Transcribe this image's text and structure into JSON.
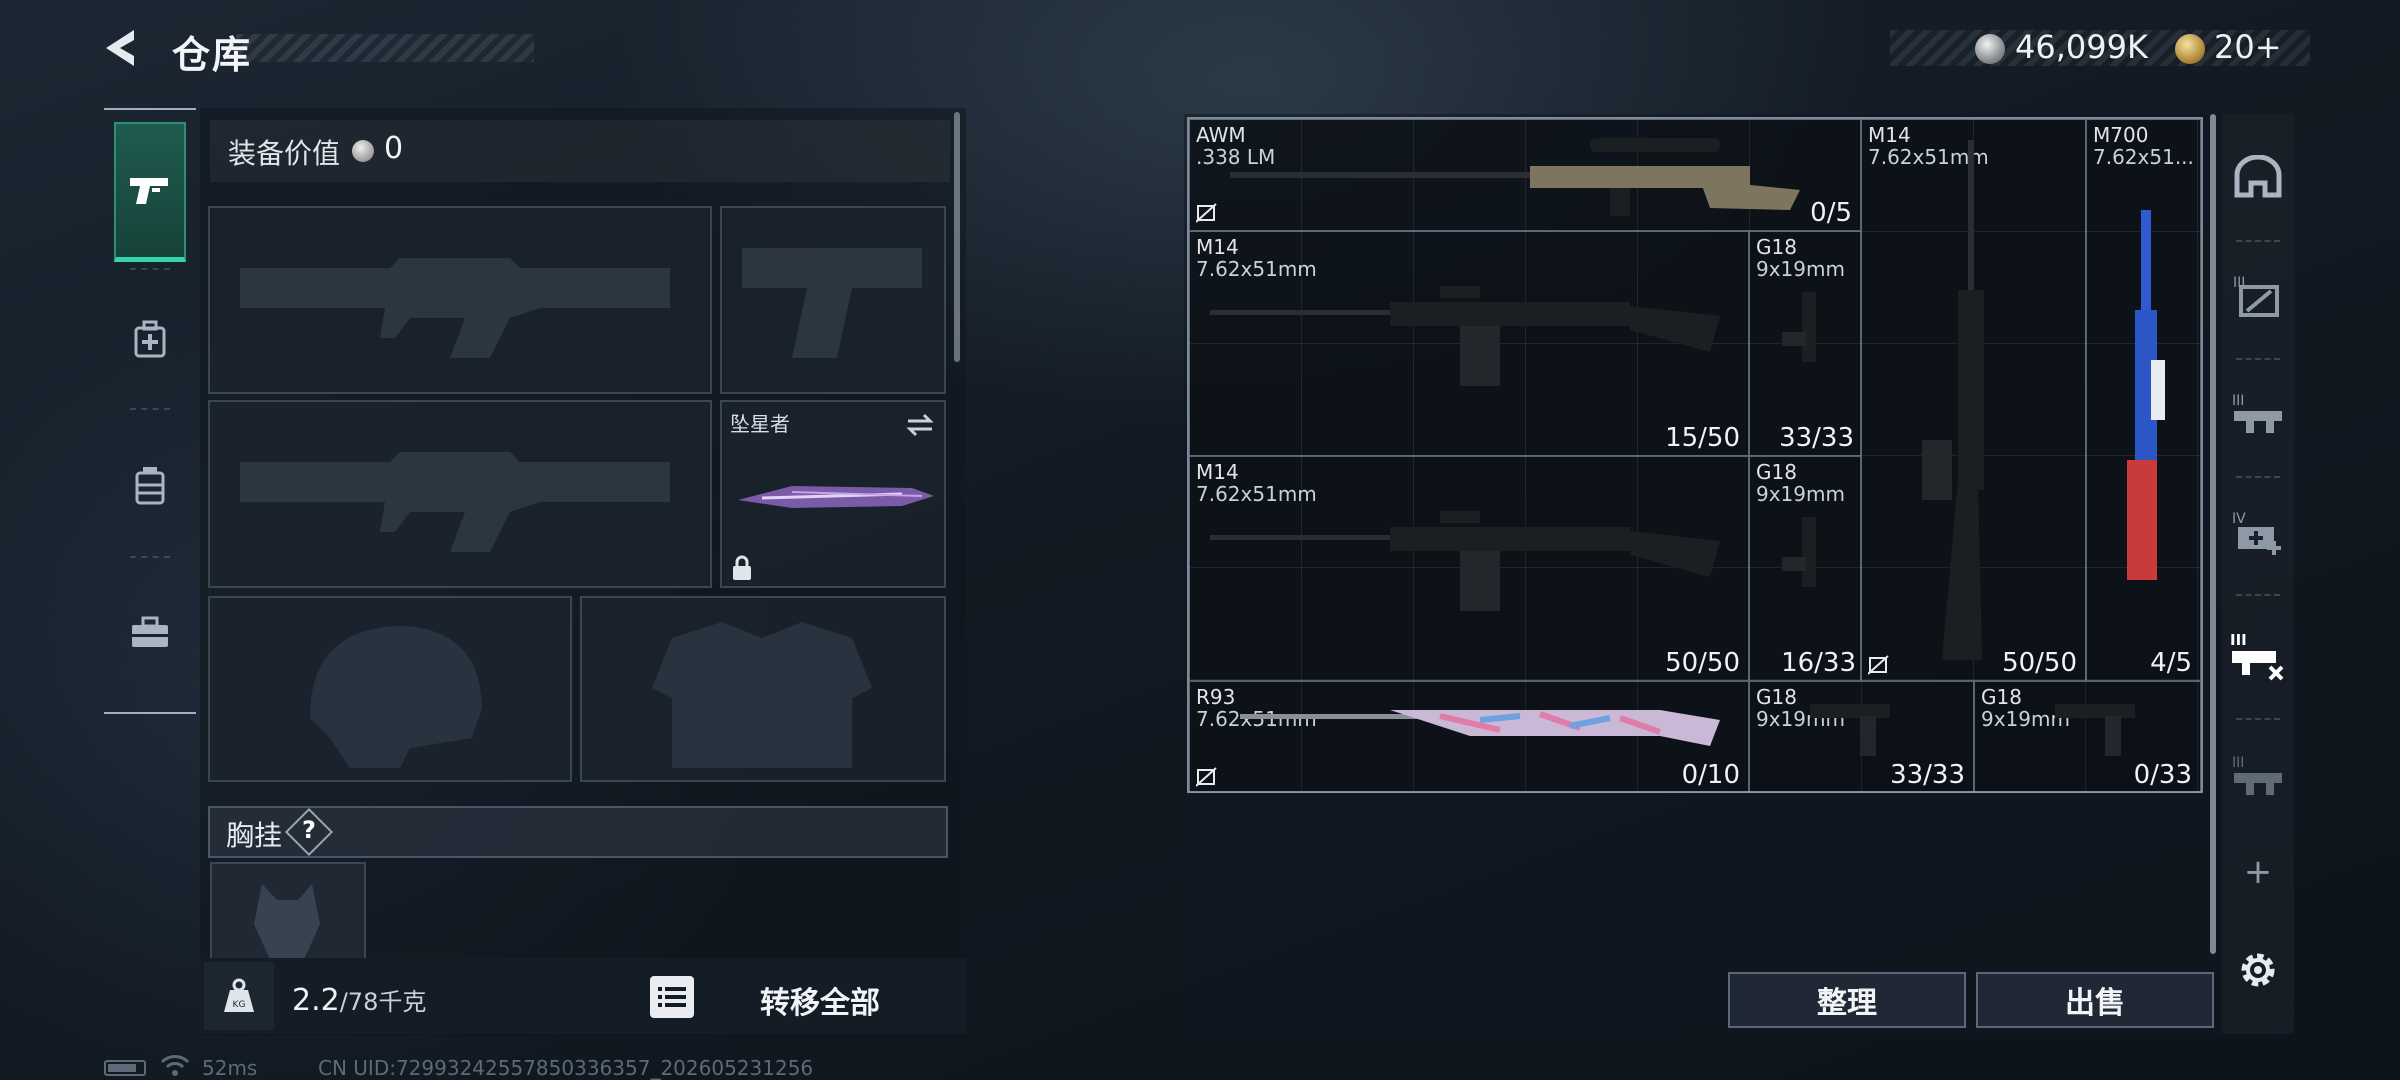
{
  "header": {
    "title": "仓库",
    "currency_silver": "46,099K",
    "currency_gold": "20+"
  },
  "sidebar": {
    "tabs": [
      {
        "name": "weapons",
        "icon": "pistol-icon",
        "active": true
      },
      {
        "name": "supplies",
        "icon": "medkit-icon",
        "active": false
      },
      {
        "name": "containers",
        "icon": "canister-icon",
        "active": false
      },
      {
        "name": "gear",
        "icon": "toolbox-icon",
        "active": false
      }
    ]
  },
  "loadout": {
    "equip_value_label": "装备价值",
    "equip_value": "0",
    "melee_label": "坠星者",
    "chest_label": "胸挂",
    "chest_help": "?",
    "weight_current": "2.2",
    "weight_max": "/78千克",
    "transfer_all": "转移全部"
  },
  "stash": {
    "items": [
      {
        "name": "AWM",
        "ammo": ".338 LM",
        "count": "0/5",
        "no_bind": true
      },
      {
        "name": "M14",
        "ammo": "7.62x51mm",
        "count": "50/50",
        "no_bind": false
      },
      {
        "name": "M700",
        "ammo": "7.62x51...",
        "count": "4/5",
        "no_bind": false
      },
      {
        "name": "M14",
        "ammo": "7.62x51mm",
        "count": "15/50",
        "no_bind": false
      },
      {
        "name": "G18",
        "ammo": "9x19mm",
        "count": "33/33",
        "no_bind": false
      },
      {
        "name": "M14",
        "ammo": "7.62x51mm",
        "count": "50/50",
        "no_bind": false
      },
      {
        "name": "G18",
        "ammo": "9x19mm",
        "count": "16/33",
        "no_bind": true
      },
      {
        "name": "R93",
        "ammo": "7.62x51mm",
        "count": "0/10",
        "no_bind": true
      },
      {
        "name": "G18",
        "ammo": "9x19mm",
        "count": "33/33",
        "no_bind": false
      },
      {
        "name": "G18",
        "ammo": "9x19mm",
        "count": "0/33",
        "no_bind": false
      }
    ],
    "sort_button": "整理",
    "sell_button": "出售"
  },
  "right_tools": {
    "items": [
      "helmet-icon",
      "armor-tier-3-icon",
      "rifle-tier-3-icon",
      "medkit-tier-4-icon",
      "rifle-tier-3-active-icon",
      "rifle-tier-3-dim-icon"
    ],
    "add": "+",
    "settings": "gear-icon"
  },
  "status_bar": {
    "ping": "52ms",
    "uid": "CN UID:72993242557850336357_202605231256"
  },
  "colors": {
    "accent_green": "#34d3a8",
    "panel_border": "#7d8a97"
  }
}
